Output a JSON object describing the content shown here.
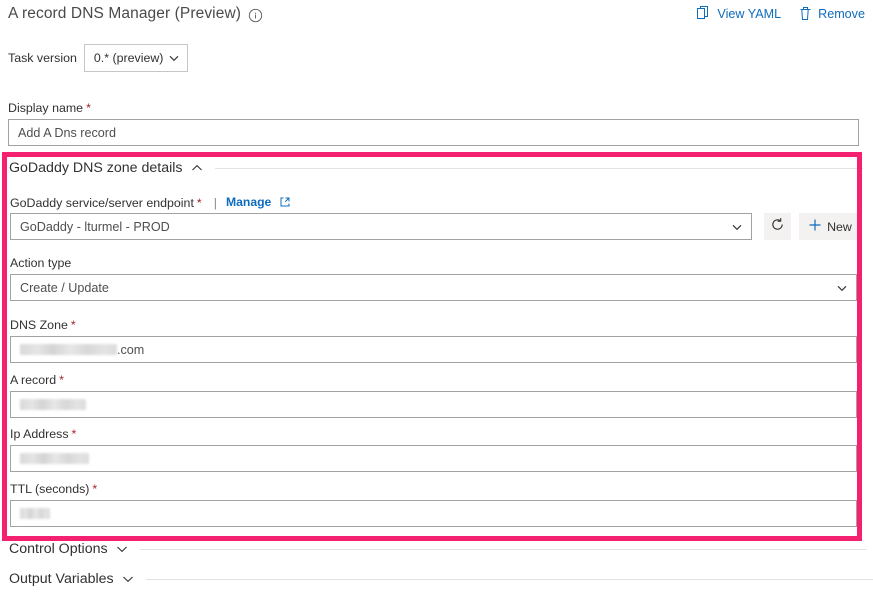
{
  "header": {
    "title": "A record DNS Manager (Preview)",
    "info_icon": "info-circle-icon",
    "actions": [
      {
        "label": "View YAML",
        "icon": "copy-document-icon"
      },
      {
        "label": "Remove",
        "icon": "trash-icon"
      }
    ]
  },
  "task_version": {
    "label": "Task version",
    "value": "0.* (preview)",
    "chevron": "chevron-down-icon"
  },
  "display_name": {
    "label": "Display name",
    "required": "*",
    "value": "Add A Dns record"
  },
  "sections": [
    {
      "name": "godaddy-dns-zone-details",
      "label": "GoDaddy DNS zone details",
      "expanded": true,
      "chevron": "chevron-up-icon"
    },
    {
      "name": "control-options",
      "label": "Control Options",
      "expanded": false,
      "chevron": "chevron-down-icon"
    },
    {
      "name": "output-variables",
      "label": "Output Variables",
      "expanded": false,
      "chevron": "chevron-down-icon"
    }
  ],
  "endpoint": {
    "label": "GoDaddy service/server endpoint",
    "required": "*",
    "separator": "|",
    "manage_label": "Manage",
    "manage_icon": "external-link-icon",
    "value": "GoDaddy - lturmel - PROD",
    "chevron": "chevron-down-icon",
    "refresh_icon": "refresh-icon",
    "new_label": "New",
    "new_icon": "plus-icon"
  },
  "action_type": {
    "label": "Action type",
    "value": "Create / Update",
    "chevron": "chevron-down-icon"
  },
  "fields": [
    {
      "name": "dns-zone",
      "label": "DNS Zone",
      "required": "*",
      "redacted": true,
      "redact_width": 97,
      "suffix": ".com"
    },
    {
      "name": "a-record",
      "label": "A record",
      "required": "*",
      "redacted": true,
      "redact_width": 66,
      "suffix": ""
    },
    {
      "name": "ip-address",
      "label": "Ip Address",
      "required": "*",
      "redacted": true,
      "redact_width": 69,
      "suffix": ""
    },
    {
      "name": "ttl",
      "label": "TTL (seconds)",
      "required": "*",
      "redacted": true,
      "redact_width": 30,
      "suffix": ""
    }
  ],
  "highlight": {
    "color": "#f32170",
    "target": "godaddy-dns-zone-details"
  },
  "colors": {
    "link": "#0f6cbd",
    "required": "#a4262c",
    "highlight": "#f32170",
    "border": "#a2a2a2"
  }
}
